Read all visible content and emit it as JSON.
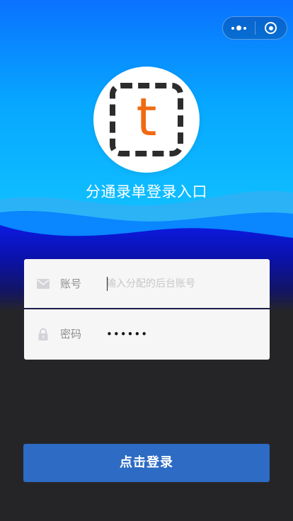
{
  "header": {
    "more_icon": "more-dots-icon",
    "close_icon": "target-circle-icon"
  },
  "brand": {
    "logo_letter": "t",
    "logo_letter_color": "#f06a12",
    "title": "分通录单登录入口"
  },
  "form": {
    "account": {
      "label": "账号",
      "placeholder": "输入分配的后台账号",
      "value": "",
      "icon": "mail-icon"
    },
    "password": {
      "label": "密码",
      "masked_value": "••••••",
      "icon": "lock-icon"
    }
  },
  "login_button": {
    "label": "点击登录",
    "color": "#2d6bc4"
  },
  "colors": {
    "background_dark": "#252528",
    "wave_light": "#35b4f2",
    "wave_mid": "#0a84ff",
    "wave_deep": "#0b1ad6"
  }
}
